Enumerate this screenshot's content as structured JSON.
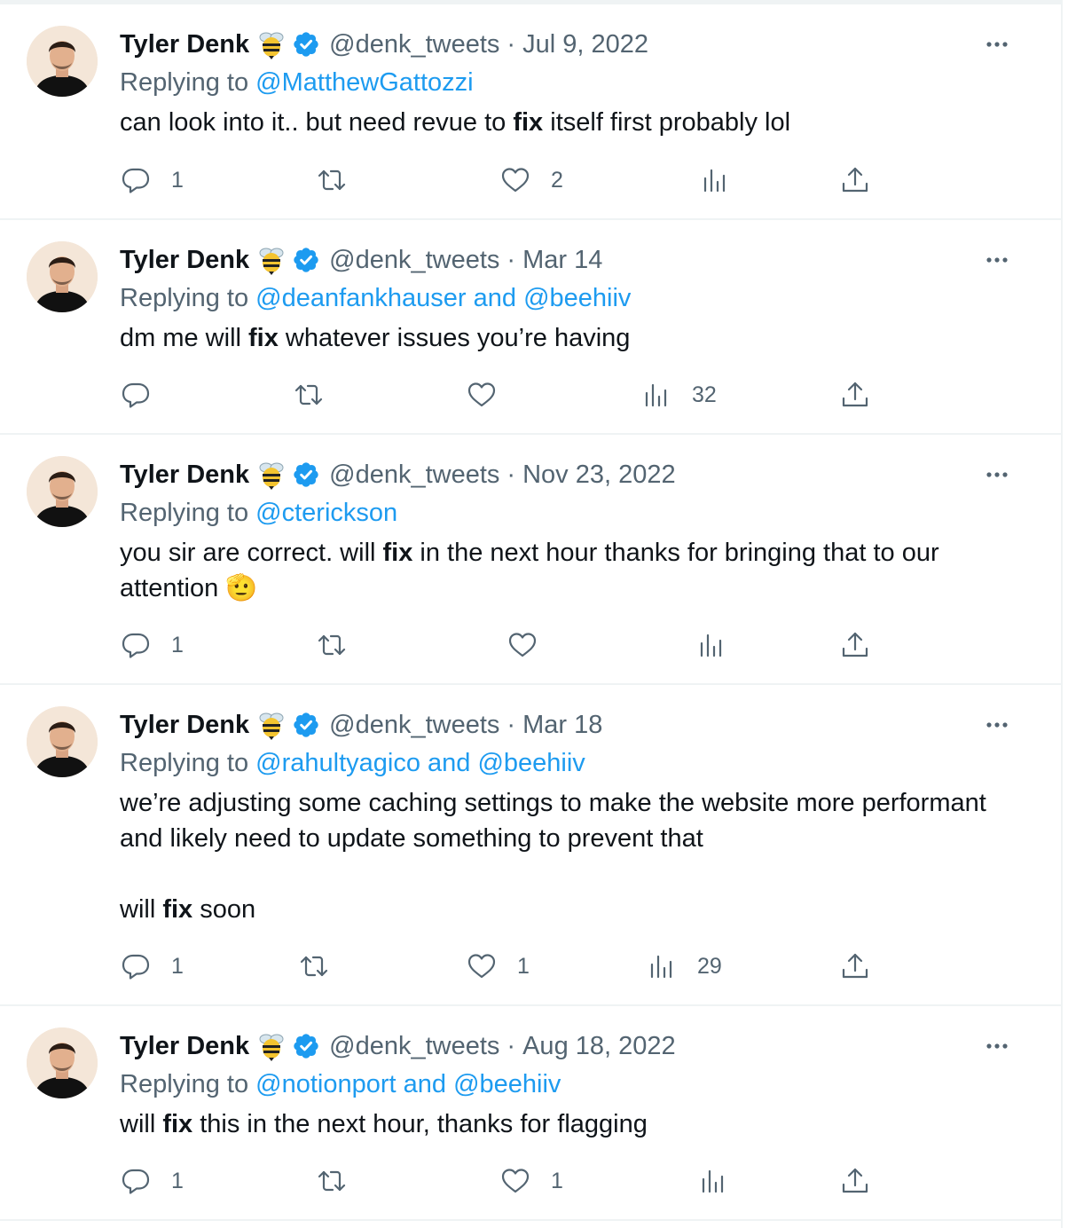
{
  "author": {
    "name": "Tyler Denk",
    "handle": "@denk_tweets"
  },
  "replying_prefix": "Replying to",
  "colors": {
    "link": "#1d9bf0",
    "muted": "#536471",
    "text": "#0f1419",
    "divider": "#eff3f4",
    "verified": "#1d9bf0"
  },
  "icons": {
    "more": "more-dots-icon",
    "reply": "reply-icon",
    "retweet": "retweet-icon",
    "like": "heart-icon",
    "views": "analytics-icon",
    "share": "share-icon",
    "badge": "verified-badge-icon",
    "emoji": "bee-emoji",
    "saluting": "saluting-face-emoji"
  },
  "tweets": [
    {
      "date": "Jul 9, 2022",
      "replying_to": "@MatthewGattozzi",
      "text_parts": [
        "can look into it.. but need revue to ",
        "fix",
        " itself first probably lol"
      ],
      "reply_count": "1",
      "retweet_count": "",
      "like_count": "2",
      "view_count": ""
    },
    {
      "date": "Mar 14",
      "replying_to": "@deanfankhauser and @beehiiv",
      "text_parts": [
        "dm me will ",
        "fix",
        " whatever issues you’re having"
      ],
      "reply_count": "",
      "retweet_count": "",
      "like_count": "",
      "view_count": "32"
    },
    {
      "date": "Nov 23, 2022",
      "replying_to": "@cterickson",
      "text_parts": [
        "you sir are correct. will ",
        "fix",
        " in the next hour thanks for bringing that to our attention"
      ],
      "emoji": "🫡",
      "reply_count": "1",
      "retweet_count": "",
      "like_count": "",
      "view_count": ""
    },
    {
      "date": "Mar 18",
      "replying_to": "@rahultyagico and @beehiiv",
      "text_parts": [
        "we’re adjusting some caching settings to make the website more performant and likely need to update something to prevent that"
      ],
      "text_parts_2": [
        "will ",
        "fix",
        " soon"
      ],
      "reply_count": "1",
      "retweet_count": "",
      "like_count": "1",
      "view_count": "29"
    },
    {
      "date": "Aug 18, 2022",
      "replying_to": "@notionport and @beehiiv",
      "text_parts": [
        "will ",
        "fix",
        " this in the next hour, thanks for flagging"
      ],
      "reply_count": "1",
      "retweet_count": "",
      "like_count": "1",
      "view_count": ""
    }
  ]
}
